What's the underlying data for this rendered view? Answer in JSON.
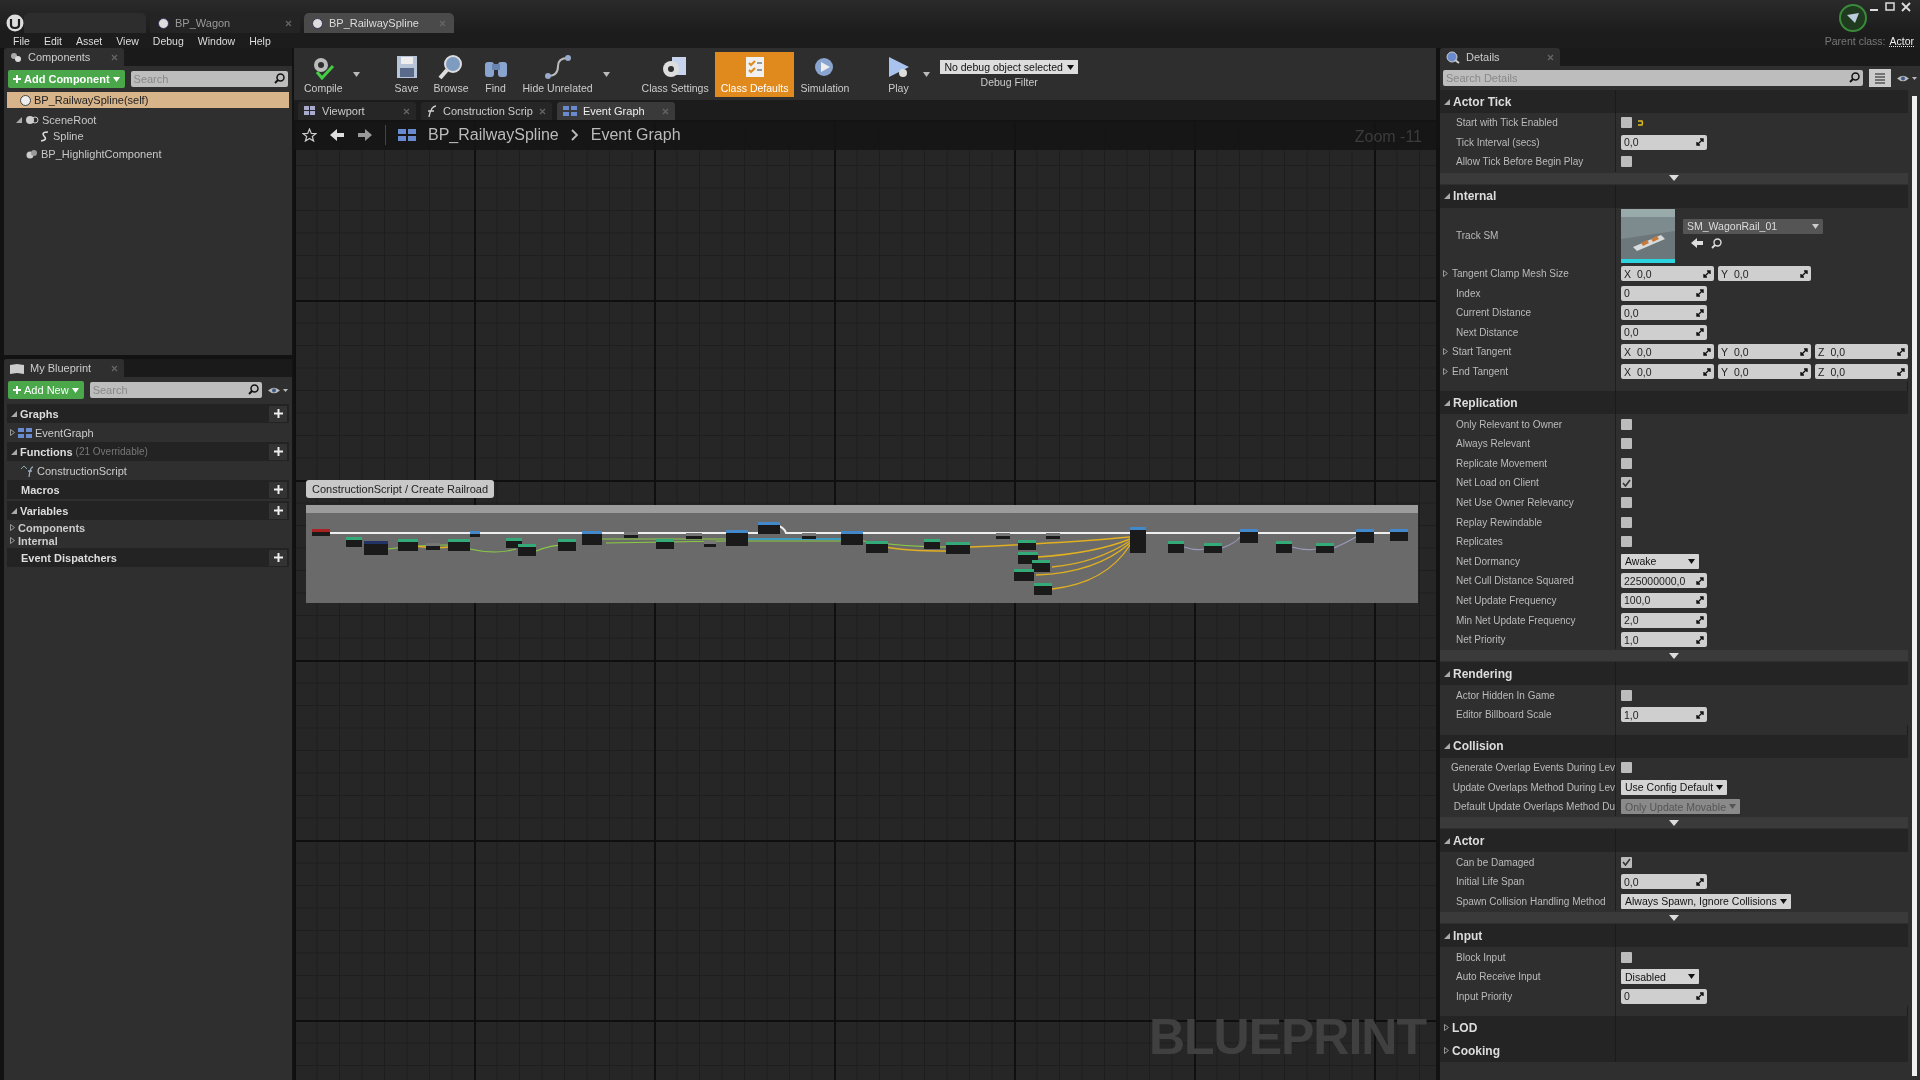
{
  "window": {
    "tabs": [
      {
        "label": "BP_Wagon",
        "selected": false
      },
      {
        "label": "BP_RailwaySpline",
        "selected": true
      }
    ],
    "parent_class": {
      "label": "Parent class:",
      "value": "Actor"
    }
  },
  "menu": [
    "File",
    "Edit",
    "Asset",
    "View",
    "Debug",
    "Window",
    "Help"
  ],
  "components": {
    "title": "Components",
    "add_button": "Add Component",
    "search": {
      "placeholder": "Search"
    },
    "tree": [
      {
        "label": "BP_RailwaySpline(self)",
        "kind": "actor",
        "selected": true
      },
      {
        "label": "SceneRoot",
        "kind": "scene",
        "selected": false,
        "children": [
          {
            "label": "Spline",
            "kind": "spline",
            "selected": false
          }
        ]
      },
      {
        "label": "BP_HighlightComponent",
        "kind": "component",
        "selected": false
      }
    ]
  },
  "my_blueprint": {
    "title": "My Blueprint",
    "add_button": "Add New",
    "search": {
      "placeholder": "Search"
    },
    "sections": [
      {
        "label": "Graphs",
        "items": [
          {
            "label": "EventGraph",
            "kind": "graph",
            "expandable": true
          }
        ]
      },
      {
        "label": "Functions",
        "note": "(21 Overridable)",
        "items": [
          {
            "label": "ConstructionScript",
            "kind": "function",
            "expandable": false
          }
        ]
      },
      {
        "label": "Macros"
      },
      {
        "label": "Variables",
        "items": [
          {
            "label": "Components",
            "kind": "category",
            "expandable": true
          },
          {
            "label": "Internal",
            "kind": "category",
            "expandable": true
          }
        ]
      },
      {
        "label": "Event Dispatchers"
      }
    ]
  },
  "toolbar": {
    "buttons": [
      {
        "label": "Compile",
        "kind": "compile",
        "selected": false,
        "dropdown": true
      },
      {
        "label": "Save",
        "kind": "save",
        "selected": false,
        "dropdown": false
      },
      {
        "label": "Browse",
        "kind": "browse",
        "selected": false,
        "dropdown": false
      },
      {
        "label": "Find",
        "kind": "find",
        "selected": false,
        "dropdown": false
      },
      {
        "label": "Hide Unrelated",
        "kind": "hide",
        "selected": false,
        "dropdown": true
      },
      {
        "label": "Class Settings",
        "kind": "settings",
        "selected": false,
        "dropdown": false
      },
      {
        "label": "Class Defaults",
        "kind": "defaults",
        "selected": true,
        "dropdown": false
      },
      {
        "label": "Simulation",
        "kind": "simulation",
        "selected": false,
        "dropdown": false
      },
      {
        "label": "Play",
        "kind": "play",
        "selected": false,
        "dropdown": true
      }
    ],
    "debug_object": {
      "value": "No debug object selected",
      "caption": "Debug Filter"
    }
  },
  "editor_tabs": [
    {
      "label": "Viewport",
      "kind": "viewport",
      "selected": false
    },
    {
      "label": "Construction Scrip",
      "kind": "function",
      "selected": false
    },
    {
      "label": "Event Graph",
      "kind": "graph",
      "selected": true
    }
  ],
  "breadcrumb": [
    "BP_RailwaySpline",
    "Event Graph"
  ],
  "graph": {
    "zoom": "Zoom -11",
    "comment": "ConstructionScript / Create Railroad",
    "watermark": "BLUEPRINT"
  },
  "details": {
    "title": "Details",
    "search": {
      "placeholder": "Search Details"
    },
    "sections": [
      {
        "title": "Actor Tick",
        "expanded": true,
        "advanced": true,
        "rows": [
          {
            "label": "Start with Tick Enabled",
            "kind": "checkbox",
            "checked": false,
            "modified": true
          },
          {
            "label": "Tick Interval (secs)",
            "kind": "number",
            "value": "0,0"
          },
          {
            "label": "Allow Tick Before Begin Play",
            "kind": "checkbox",
            "checked": false,
            "modified": false
          }
        ]
      },
      {
        "title": "Internal",
        "expanded": true,
        "advanced": false,
        "rows": [
          {
            "label": "Track SM",
            "kind": "asset",
            "value": "SM_WagonRail_01"
          },
          {
            "label": "Tangent Clamp Mesh Size",
            "kind": "vector",
            "values": [
              {
                "axis": "X",
                "value": "0,0"
              },
              {
                "axis": "Y",
                "value": "0,0"
              }
            ]
          },
          {
            "label": "Index",
            "kind": "number",
            "value": "0"
          },
          {
            "label": "Current Distance",
            "kind": "number",
            "value": "0,0"
          },
          {
            "label": "Next Distance",
            "kind": "number",
            "value": "0,0"
          },
          {
            "label": "Start Tangent",
            "kind": "vector",
            "values": [
              {
                "axis": "X",
                "value": "0,0"
              },
              {
                "axis": "Y",
                "value": "0,0"
              },
              {
                "axis": "Z",
                "value": "0,0"
              }
            ]
          },
          {
            "label": "End Tangent",
            "kind": "vector",
            "values": [
              {
                "axis": "X",
                "value": "0,0"
              },
              {
                "axis": "Y",
                "value": "0,0"
              },
              {
                "axis": "Z",
                "value": "0,0"
              }
            ]
          }
        ]
      },
      {
        "title": "Replication",
        "expanded": true,
        "advanced": true,
        "rows": [
          {
            "label": "Only Relevant to Owner",
            "kind": "checkbox",
            "checked": false,
            "modified": false
          },
          {
            "label": "Always Relevant",
            "kind": "checkbox",
            "checked": false,
            "modified": false
          },
          {
            "label": "Replicate Movement",
            "kind": "checkbox",
            "checked": false,
            "modified": false
          },
          {
            "label": "Net Load on Client",
            "kind": "checkbox",
            "checked": true,
            "modified": false
          },
          {
            "label": "Net Use Owner Relevancy",
            "kind": "checkbox",
            "checked": false,
            "modified": false
          },
          {
            "label": "Replay Rewindable",
            "kind": "checkbox",
            "checked": false,
            "modified": false
          },
          {
            "label": "Replicates",
            "kind": "checkbox",
            "checked": false,
            "modified": false
          },
          {
            "label": "Net Dormancy",
            "kind": "dropdown",
            "value": "Awake",
            "disabled": false
          },
          {
            "label": "Net Cull Distance Squared",
            "kind": "number",
            "value": "225000000,0"
          },
          {
            "label": "Net Update Frequency",
            "kind": "number",
            "value": "100,0"
          },
          {
            "label": "Min Net Update Frequency",
            "kind": "number",
            "value": "2,0"
          },
          {
            "label": "Net Priority",
            "kind": "number",
            "value": "1,0"
          }
        ]
      },
      {
        "title": "Rendering",
        "expanded": true,
        "advanced": false,
        "rows": [
          {
            "label": "Actor Hidden In Game",
            "kind": "checkbox",
            "checked": false,
            "modified": false
          },
          {
            "label": "Editor Billboard Scale",
            "kind": "number",
            "value": "1,0"
          }
        ]
      },
      {
        "title": "Collision",
        "expanded": true,
        "advanced": true,
        "rows": [
          {
            "label": "Generate Overlap Events During Lev",
            "kind": "checkbox",
            "checked": false,
            "modified": false
          },
          {
            "label": "Update Overlaps Method During Lev",
            "kind": "dropdown",
            "value": "Use Config Default",
            "disabled": false
          },
          {
            "label": "Default Update Overlaps Method Du",
            "kind": "dropdown",
            "value": "Only Update Movable",
            "disabled": true
          }
        ]
      },
      {
        "title": "Actor",
        "expanded": true,
        "advanced": true,
        "rows": [
          {
            "label": "Can be Damaged",
            "kind": "checkbox",
            "checked": true,
            "modified": false
          },
          {
            "label": "Initial Life Span",
            "kind": "number",
            "value": "0,0"
          },
          {
            "label": "Spawn Collision Handling Method",
            "kind": "dropdown",
            "value": "Always Spawn, Ignore Collisions",
            "disabled": false
          }
        ]
      },
      {
        "title": "Input",
        "expanded": true,
        "advanced": false,
        "rows": [
          {
            "label": "Block Input",
            "kind": "checkbox",
            "checked": false,
            "modified": false
          },
          {
            "label": "Auto Receive Input",
            "kind": "dropdown",
            "value": "Disabled",
            "disabled": false
          },
          {
            "label": "Input Priority",
            "kind": "number",
            "value": "0"
          }
        ]
      },
      {
        "title": "LOD",
        "expanded": false,
        "advanced": false
      },
      {
        "title": "Cooking",
        "expanded": false,
        "advanced": false
      }
    ]
  }
}
